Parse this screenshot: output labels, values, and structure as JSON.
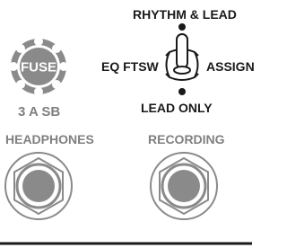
{
  "switch": {
    "top_label": "RHYTHM & LEAD",
    "left_label": "EQ FTSW",
    "right_label": "ASSIGN",
    "bottom_label": "LEAD ONLY"
  },
  "fuse": {
    "cap_label": "FUSE",
    "rating_label": "3 A SB"
  },
  "jacks": {
    "headphones_label": "HEADPHONES",
    "recording_label": "RECORDING"
  }
}
